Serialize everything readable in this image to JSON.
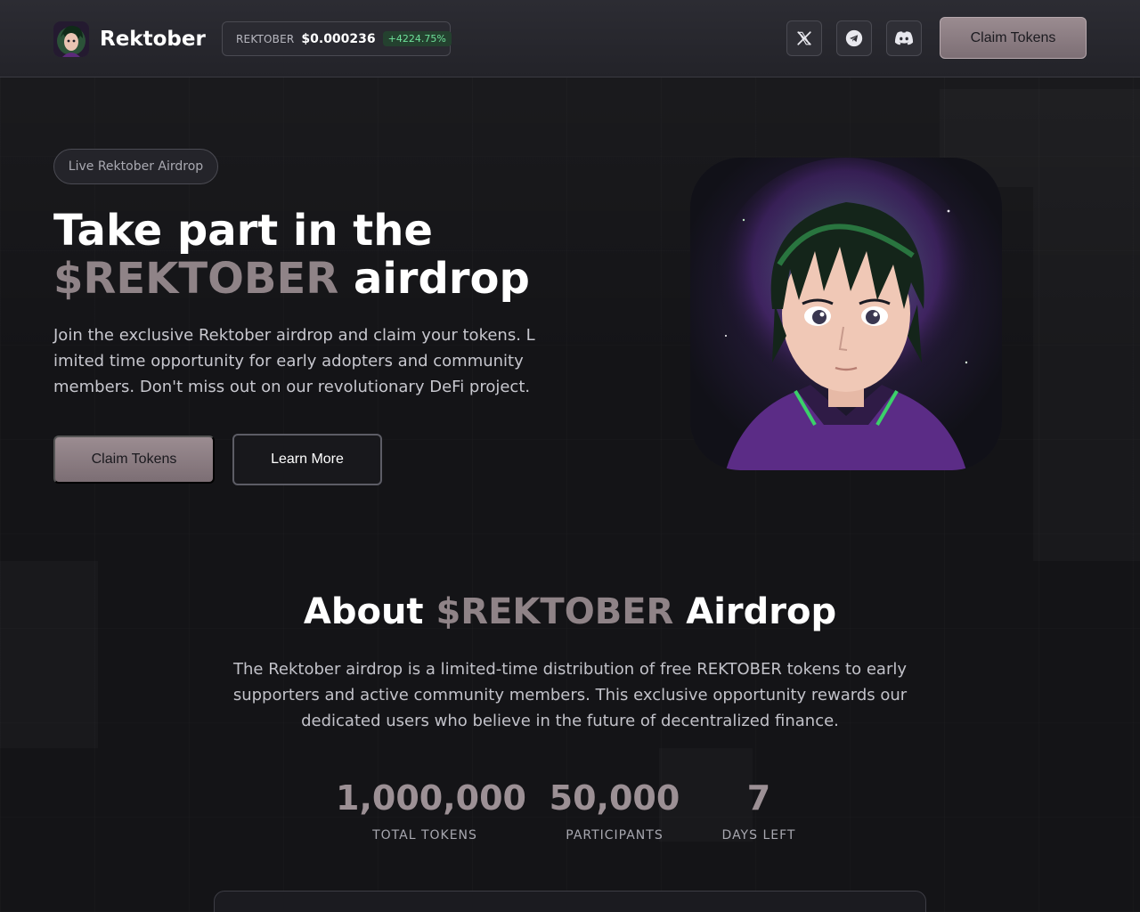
{
  "header": {
    "brand_name": "Rektober",
    "ticker": {
      "symbol": "REKTOBER",
      "price": "$0.000236",
      "change": "+4224.75%"
    },
    "social": [
      {
        "name": "x-icon"
      },
      {
        "name": "telegram-icon"
      },
      {
        "name": "discord-icon"
      }
    ],
    "claim_label": "Claim Tokens"
  },
  "hero": {
    "badge": "Live Rektober Airdrop",
    "title_line1": "Take part in the",
    "title_accent": "$REKTOBER",
    "title_rest": " airdrop",
    "description": " Join the exclusive Rektober airdrop and claim your tokens. Limited time opportunity for early adopters and community members. Don't miss out on our revolutionary DeFi project.",
    "primary_button": "Claim Tokens",
    "secondary_button": "Learn More"
  },
  "about": {
    "title_prefix": "About ",
    "title_accent": "$REKTOBER",
    "title_suffix": " Airdrop",
    "description": "The Rektober airdrop is a limited-time distribution of free REKTOBER tokens to early supporters and active community members. This exclusive opportunity rewards our dedicated users who believe in the future of decentralized finance.",
    "stats": [
      {
        "value": "1,000,000",
        "label": "TOTAL TOKENS"
      },
      {
        "value": "50,000",
        "label": "PARTICIPANTS"
      },
      {
        "value": "7",
        "label": "DAYS LEFT"
      }
    ]
  },
  "colors": {
    "background": "#141417",
    "accent": "#8f8387",
    "button_primary": "#8c7e83",
    "positive": "#6fe09a"
  }
}
